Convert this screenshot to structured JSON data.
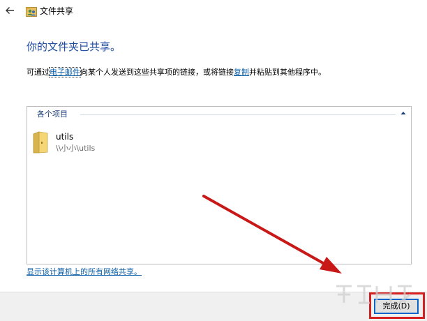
{
  "window": {
    "title": "文件共享",
    "back_icon": "back-arrow-icon",
    "title_icon": "file-share-icon"
  },
  "main": {
    "heading": "你的文件夹已共享。",
    "instruction": {
      "prefix": "可通过",
      "email_link": "电子邮件",
      "middle": "向某个人发送到这些共享项的链接，或将链接",
      "copy_link": "复制",
      "suffix": "并粘贴到其他程序中。"
    }
  },
  "items_panel": {
    "group_header": "各个项目",
    "collapse_icon": "chevron-up-icon",
    "items": [
      {
        "name": "utils",
        "path": "\\\\小小\\utils",
        "icon": "folder-icon"
      }
    ]
  },
  "network_link": "显示该计算机上的所有网络共享。",
  "footer": {
    "finish_button": "完成(D)"
  },
  "annotation": {
    "arrow_color": "#d42020",
    "highlight_color": "#d42020"
  },
  "colors": {
    "heading": "#1b4aa0",
    "link": "#0b5ea8",
    "footer_bg": "#f0f0f0"
  }
}
